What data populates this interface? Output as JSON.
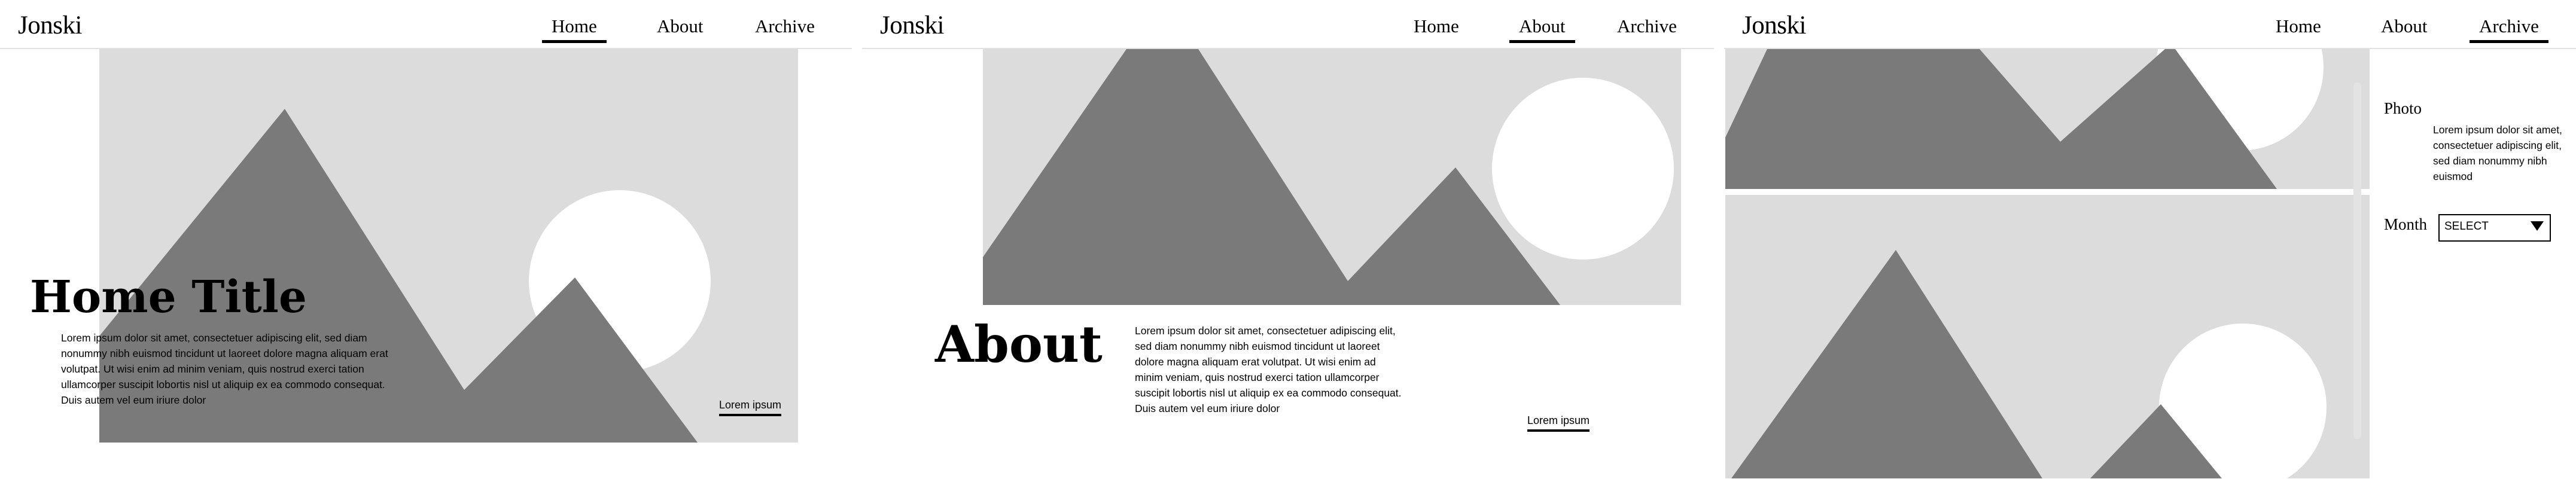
{
  "brand": "Jonski",
  "nav": {
    "home": "Home",
    "about": "About",
    "archive": "Archive"
  },
  "home": {
    "title": "Home Title",
    "body": "Lorem ipsum dolor sit amet, consectetuer adipiscing elit, sed diam nonummy nibh euismod tincidunt ut laoreet dolore magna aliquam erat volutpat. Ut wisi enim ad minim veniam, quis nostrud exerci tation ullamcorper suscipit lobortis nisl ut aliquip ex ea commodo consequat. Duis autem vel eum iriure dolor",
    "link": "Lorem ipsum"
  },
  "about": {
    "title": "About",
    "body": "Lorem ipsum dolor sit amet, consectetuer adipiscing elit, sed diam nonummy nibh euismod tincidunt ut laoreet dolore magna aliquam erat volutpat. Ut wisi enim ad minim veniam, quis nostrud exerci tation ullamcorper suscipit lobortis nisl ut aliquip ex ea commodo consequat. Duis autem vel eum iriure dolor",
    "link": "Lorem ipsum"
  },
  "archive": {
    "photo_label": "Photo",
    "photo_desc": "Lorem ipsum dolor sit amet, consectetuer adipiscing elit, sed diam nonummy nibh euismod",
    "month_label": "Month",
    "month_select": "SELECT"
  },
  "colors": {
    "placeholder_bg": "#dcdcdc",
    "mountain": "#7a7a7a",
    "sun": "#ffffff"
  }
}
